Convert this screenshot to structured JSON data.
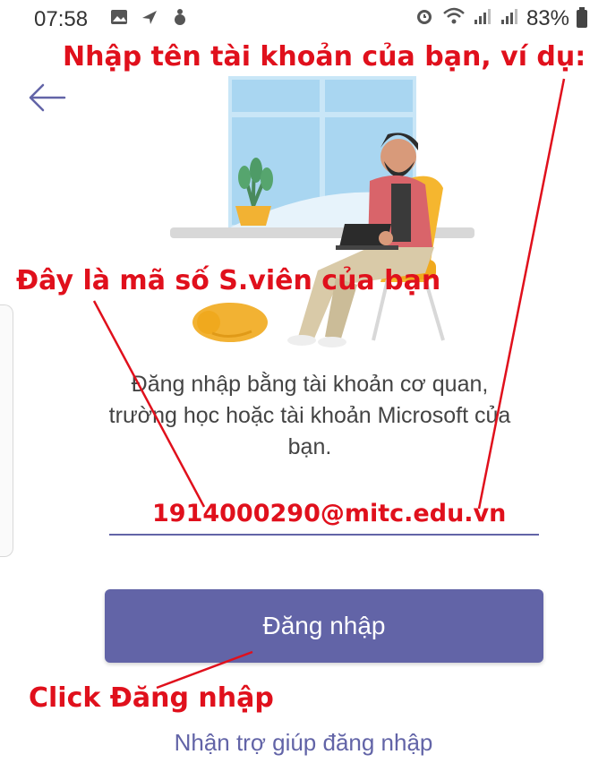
{
  "status_bar": {
    "time": "07:58",
    "battery_percent": "83%",
    "icons_left": [
      "image-icon",
      "navigation-icon",
      "app-icon"
    ],
    "icons_right": [
      "alarm-icon",
      "wifi-icon",
      "signal-icon",
      "signal-icon",
      "battery-icon"
    ]
  },
  "header": {
    "back_icon": "arrow-left-icon"
  },
  "login": {
    "description_lines": [
      "Đăng nhập bằng tài khoản cơ quan,",
      "trường học hoặc tài khoản Microsoft của",
      "bạn."
    ],
    "account_value": "",
    "login_button_label": "Đăng nhập",
    "help_link_label": "Nhận trợ giúp đăng nhập"
  },
  "annotations": {
    "top": "Nhập tên tài khoản của bạn, ví dụ:",
    "middle": "Đây là mã số S.viên của bạn",
    "email_example": "1914000290@mitc.edu.vn",
    "bottom": "Click Đăng nhập",
    "color": "#e0101c"
  },
  "colors": {
    "accent": "#6264a7",
    "annotation": "#e0101c"
  }
}
